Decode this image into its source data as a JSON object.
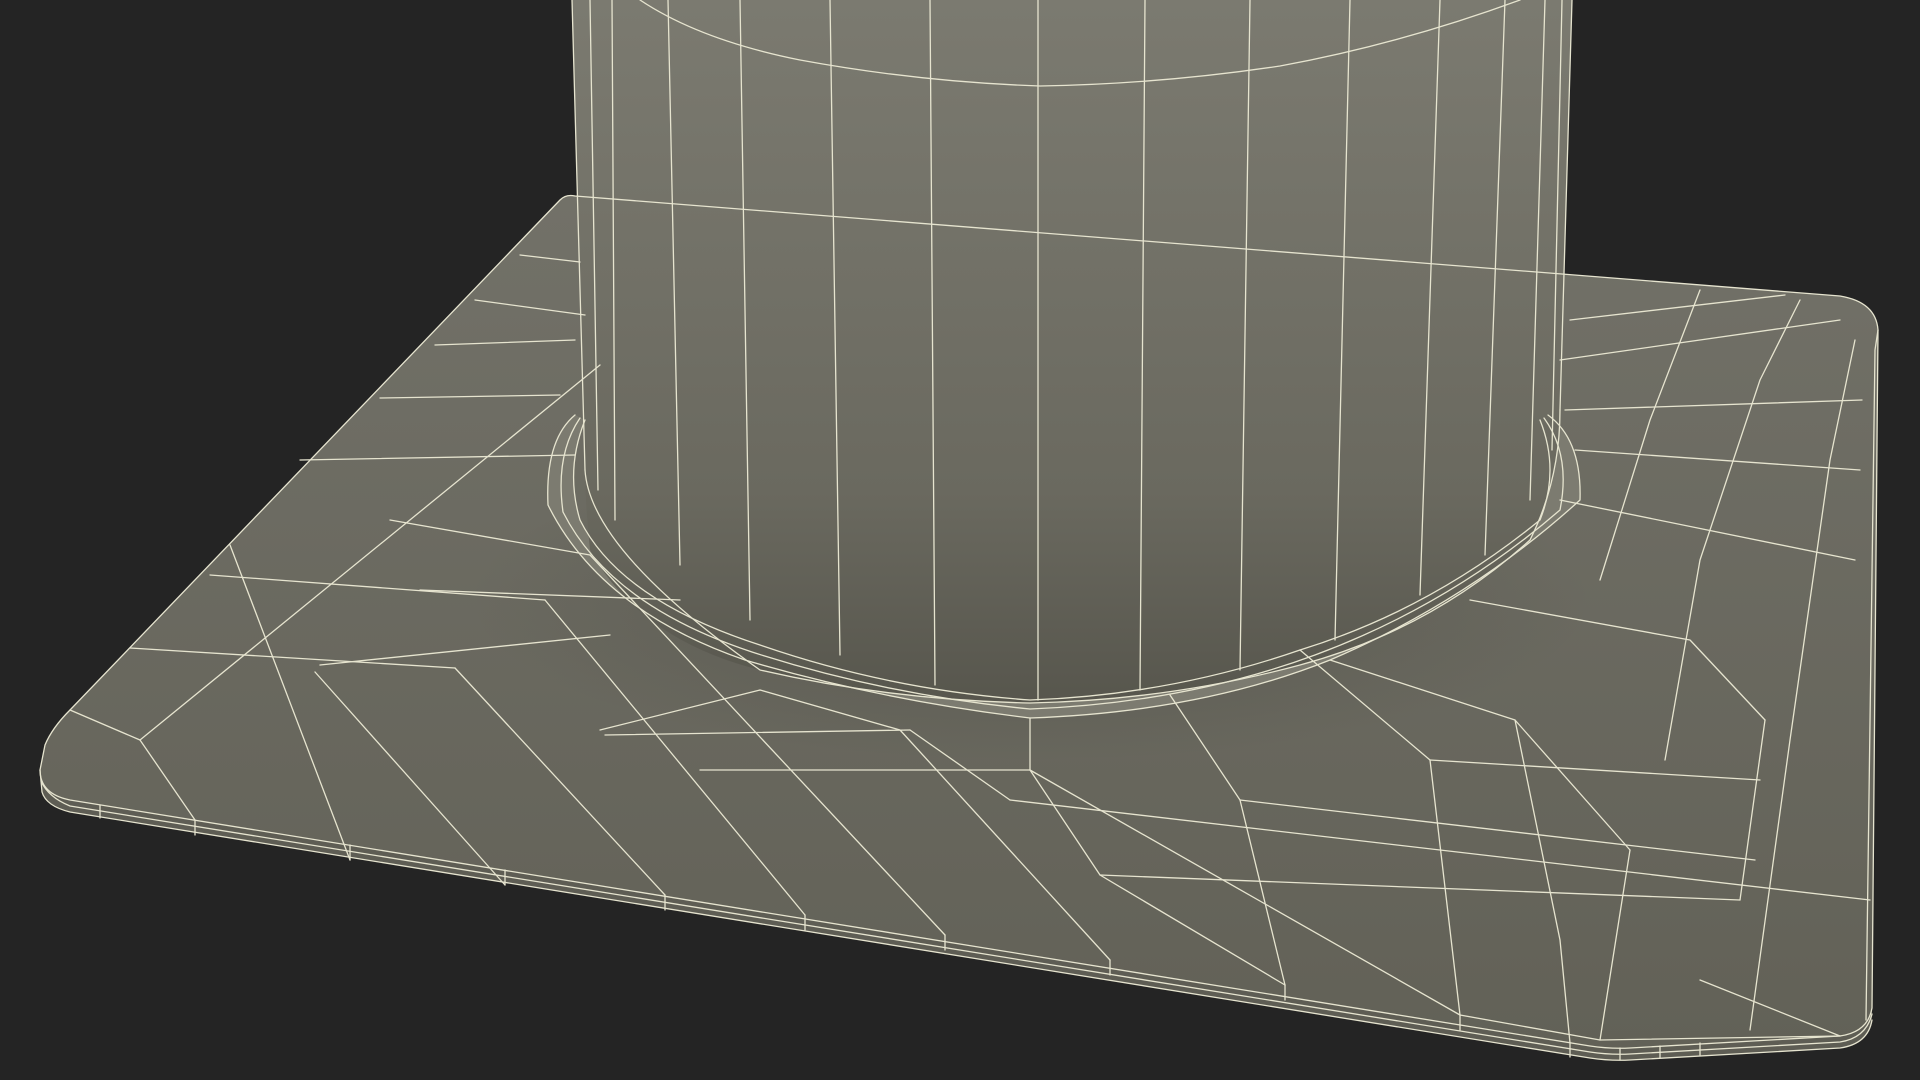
{
  "scene": {
    "background_color": "#242424",
    "mesh_face_color": "#6e6d63",
    "mesh_face_shadow_color": "#5a5950",
    "wireframe_color": "#e6e4cf",
    "subject": "wireframe-render"
  }
}
